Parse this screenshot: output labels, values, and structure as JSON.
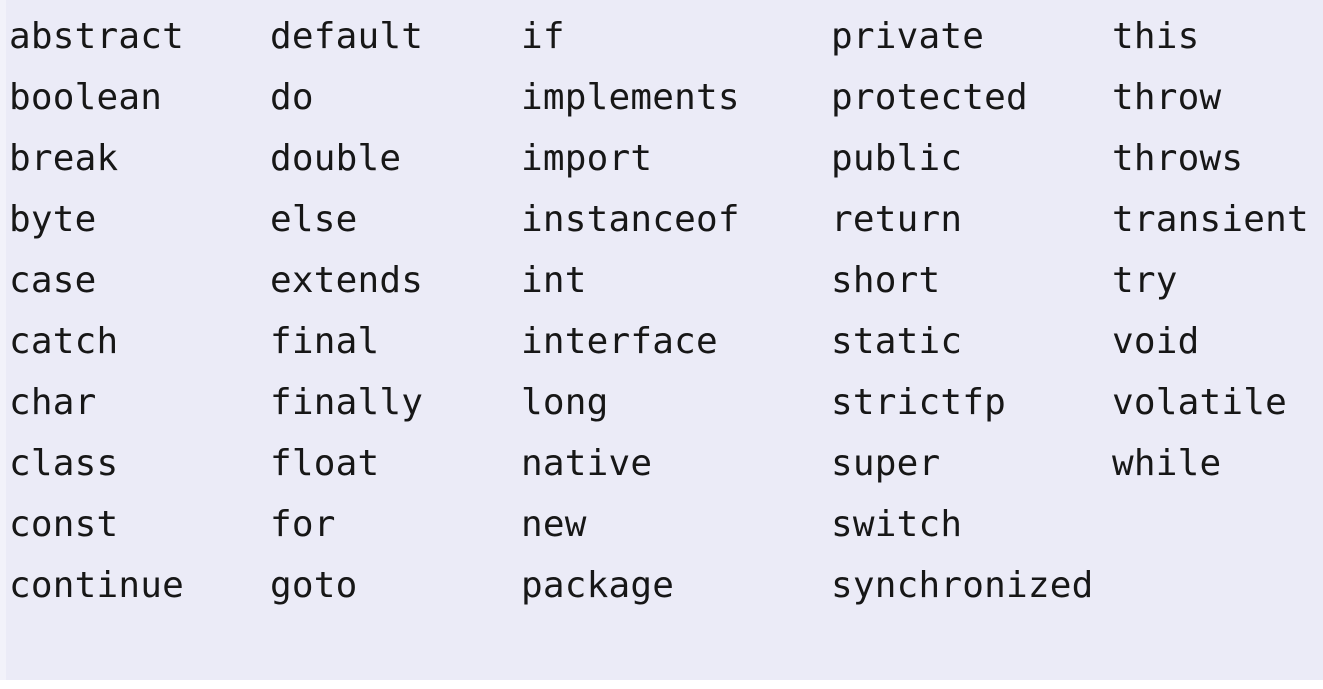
{
  "document": {
    "kind": "java-keyword-reference-table",
    "colors": {
      "background": "#ebebf7",
      "text": "#171717",
      "page": "#ffffff"
    },
    "columns": [
      {
        "index": 0,
        "keywords": [
          "abstract",
          "boolean",
          "break",
          "byte",
          "case",
          "catch",
          "char",
          "class",
          "const",
          "continue"
        ]
      },
      {
        "index": 1,
        "keywords": [
          "default",
          "do",
          "double",
          "else",
          "extends",
          "final",
          "finally",
          "float",
          "for",
          "goto"
        ]
      },
      {
        "index": 2,
        "keywords": [
          "if",
          "implements",
          "import",
          "instanceof",
          "int",
          "interface",
          "long",
          "native",
          "new",
          "package"
        ]
      },
      {
        "index": 3,
        "keywords": [
          "private",
          "protected",
          "public",
          "return",
          "short",
          "static",
          "strictfp",
          "super",
          "switch",
          "synchronized"
        ]
      },
      {
        "index": 4,
        "keywords": [
          "this",
          "throw",
          "throws",
          "transient",
          "try",
          "void",
          "volatile",
          "while"
        ]
      }
    ]
  }
}
